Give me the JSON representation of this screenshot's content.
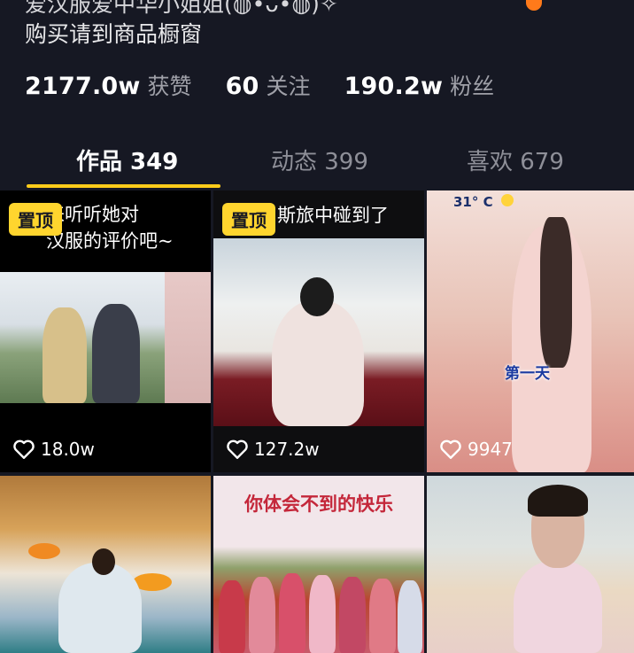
{
  "profile": {
    "bio_line1": "爱汉服爱中华小姐姐(◍•ᴗ•◍)✧",
    "bio_line2": "购买请到商品橱窗"
  },
  "stats": [
    {
      "value": "2177.0w",
      "label": "获赞"
    },
    {
      "value": "60",
      "label": "关注"
    },
    {
      "value": "190.2w",
      "label": "粉丝"
    }
  ],
  "tabs": [
    {
      "label": "作品 349",
      "active": true
    },
    {
      "label": "动态 399",
      "active": false
    },
    {
      "label": "喜欢 679",
      "active": false
    }
  ],
  "videos": [
    {
      "pinned_label": "置顶",
      "caption": "来听听她对\n汉服的评价吧~",
      "likes": "18.0w"
    },
    {
      "pinned_label": "置顶",
      "caption": "斯旅中碰到了",
      "likes": "127.2w"
    },
    {
      "overlay_temp": "31° C",
      "overlay_text": "第一天",
      "likes": "9947"
    },
    {},
    {
      "caption": "你体会不到的快乐"
    },
    {}
  ],
  "colors": {
    "background": "#161823",
    "accent_underline": "#ffcc1a",
    "pin_badge": "#ffd52e",
    "muted_text": "#9fa0a8"
  },
  "icons": {
    "likes": "heart-outline-icon"
  }
}
